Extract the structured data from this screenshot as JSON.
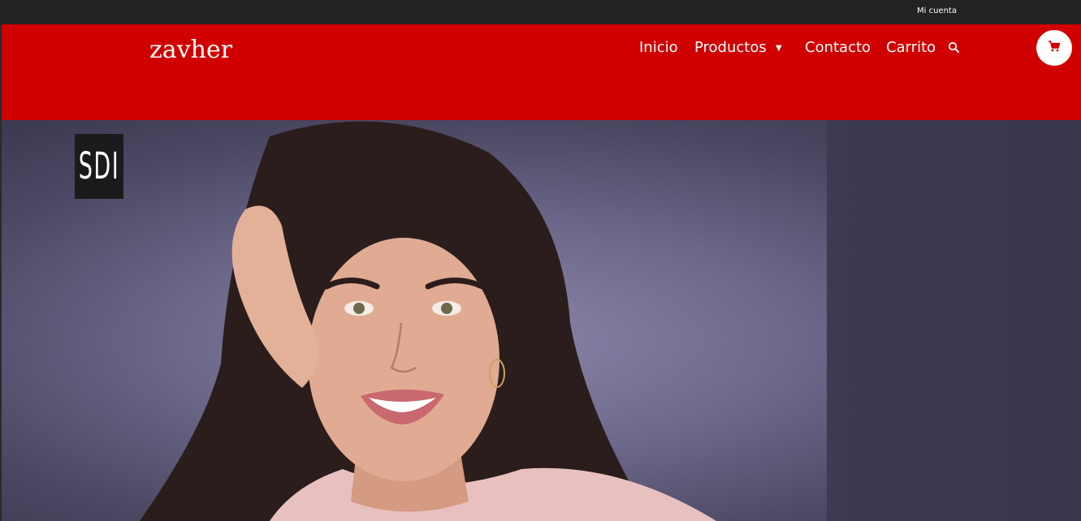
{
  "topbar": {
    "account_link": "Mi cuenta"
  },
  "header": {
    "logo": "zavher",
    "nav": [
      {
        "label": "Inicio"
      },
      {
        "label": "Productos",
        "has_dropdown": true
      },
      {
        "label": "Contacto"
      },
      {
        "label": "Carrito"
      }
    ],
    "search_icon": "search-icon",
    "cart_icon": "shopping-cart-icon",
    "dropdown_icon": "caret-down-icon"
  },
  "hero": {
    "badge_text": "SDI",
    "image": "smiling-woman-portrait"
  },
  "colors": {
    "topbar": "#222222",
    "header": "#d10000",
    "cart_icon": "#d10000"
  }
}
